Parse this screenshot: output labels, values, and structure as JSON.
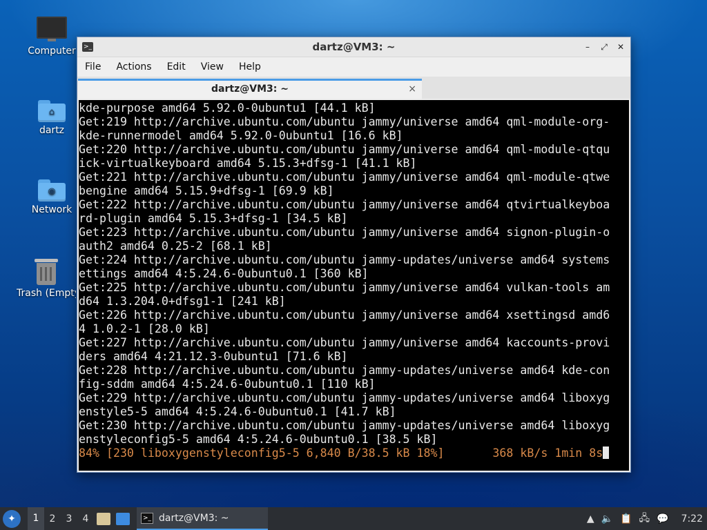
{
  "desktop": {
    "icons": [
      {
        "label": "Computer",
        "icon": "computer-icon"
      },
      {
        "label": "dartz",
        "icon": "home-folder-icon"
      },
      {
        "label": "Network",
        "icon": "network-folder-icon"
      },
      {
        "label": "Trash (Empty)",
        "icon": "trash-icon"
      }
    ]
  },
  "window": {
    "title": "dartz@VM3: ~",
    "menu": [
      "File",
      "Actions",
      "Edit",
      "View",
      "Help"
    ],
    "tab": {
      "label": "dartz@VM3: ~",
      "close": "×"
    },
    "controls": {
      "minimize": "–",
      "maximize": "⤢",
      "close": "✕"
    }
  },
  "terminal": {
    "lines": [
      "kde-purpose amd64 5.92.0-0ubuntu1 [44.1 kB]",
      "Get:219 http://archive.ubuntu.com/ubuntu jammy/universe amd64 qml-module-org-",
      "kde-runnermodel amd64 5.92.0-0ubuntu1 [16.6 kB]",
      "Get:220 http://archive.ubuntu.com/ubuntu jammy/universe amd64 qml-module-qtqu",
      "ick-virtualkeyboard amd64 5.15.3+dfsg-1 [41.1 kB]",
      "Get:221 http://archive.ubuntu.com/ubuntu jammy/universe amd64 qml-module-qtwe",
      "bengine amd64 5.15.9+dfsg-1 [69.9 kB]",
      "Get:222 http://archive.ubuntu.com/ubuntu jammy/universe amd64 qtvirtualkeyboa",
      "rd-plugin amd64 5.15.3+dfsg-1 [34.5 kB]",
      "Get:223 http://archive.ubuntu.com/ubuntu jammy/universe amd64 signon-plugin-o",
      "auth2 amd64 0.25-2 [68.1 kB]",
      "Get:224 http://archive.ubuntu.com/ubuntu jammy-updates/universe amd64 systems",
      "ettings amd64 4:5.24.6-0ubuntu0.1 [360 kB]",
      "Get:225 http://archive.ubuntu.com/ubuntu jammy/universe amd64 vulkan-tools am",
      "d64 1.3.204.0+dfsg1-1 [241 kB]",
      "Get:226 http://archive.ubuntu.com/ubuntu jammy/universe amd64 xsettingsd amd6",
      "4 1.0.2-1 [28.0 kB]",
      "Get:227 http://archive.ubuntu.com/ubuntu jammy/universe amd64 kaccounts-provi",
      "ders amd64 4:21.12.3-0ubuntu1 [71.6 kB]",
      "Get:228 http://archive.ubuntu.com/ubuntu jammy-updates/universe amd64 kde-con",
      "fig-sddm amd64 4:5.24.6-0ubuntu0.1 [110 kB]",
      "Get:229 http://archive.ubuntu.com/ubuntu jammy-updates/universe amd64 liboxyg",
      "enstyle5-5 amd64 4:5.24.6-0ubuntu0.1 [41.7 kB]",
      "Get:230 http://archive.ubuntu.com/ubuntu jammy-updates/universe amd64 liboxyg",
      "enstyleconfig5-5 amd64 4:5.24.6-0ubuntu0.1 [38.5 kB]"
    ],
    "progress_line": "84% [230 liboxygenstyleconfig5-5 6,840 B/38.5 kB 18%]       368 kB/s 1min 8s",
    "progress_color": "#d98a4a"
  },
  "taskbar": {
    "workspaces": [
      "1",
      "2",
      "3",
      "4"
    ],
    "active_workspace": "1",
    "task_label": "dartz@VM3: ~",
    "clock": "7:22",
    "tray_icons": [
      "updates-icon",
      "volume-icon",
      "clipboard-icon",
      "network-icon",
      "notifications-icon"
    ],
    "accent": "#4a9be6"
  }
}
